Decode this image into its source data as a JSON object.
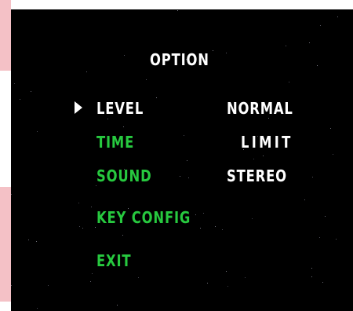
{
  "menu": {
    "title": "OPTION",
    "cursor_icon": "triangle-right-icon",
    "items": [
      {
        "label": "LEVEL",
        "value": "NORMAL",
        "selected": true
      },
      {
        "label": "TIME",
        "value": "LIMIT",
        "selected": false
      },
      {
        "label": "SOUND",
        "value": "STEREO",
        "selected": false
      },
      {
        "label": "KEY CONFIG",
        "selected": false
      },
      {
        "label": "EXIT",
        "selected": false
      }
    ]
  },
  "colors": {
    "background": "#000000",
    "selected_text": "#ffffff",
    "unselected_text": "#27c93f",
    "value_text": "#ffffff",
    "title_text": "#ffffff"
  }
}
